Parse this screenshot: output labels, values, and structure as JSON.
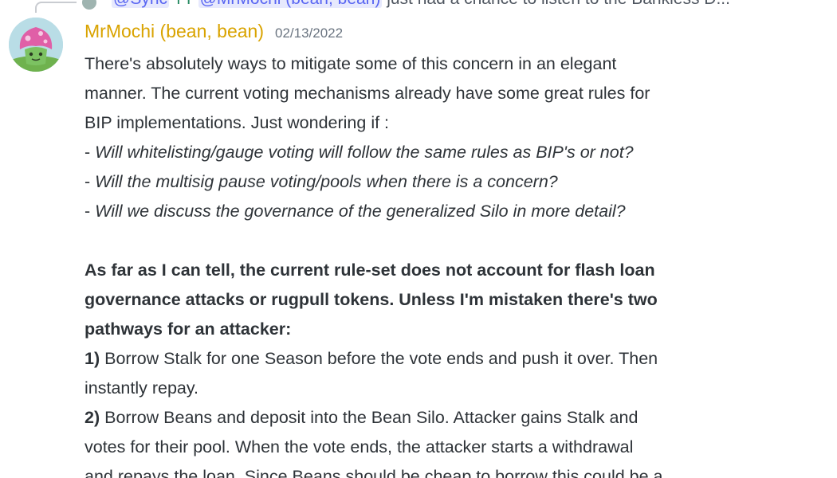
{
  "reply": {
    "mention_1": "@Sync",
    "author_tail": "TT",
    "mention_2": "@MrMochi (bean, bean)",
    "snippet": "just had a chance to listen to the Bankless D..."
  },
  "message": {
    "author": "MrMochi (bean, bean)",
    "timestamp": "02/13/2022",
    "author_color": "#d9a300",
    "lines": [
      "There's absolutely ways to mitigate some of this concern in an elegant",
      "manner. The current voting mechanisms already have some great rules for",
      "BIP implementations. Just wondering if :"
    ],
    "bullets": [
      {
        "dash": "- ",
        "text": "Will whitelisting/gauge voting will follow the same rules as BIP's or not?"
      },
      {
        "dash": "- ",
        "text": "Will the multisig pause voting/pools when there is a concern?"
      },
      {
        "dash": "- ",
        "text": "Will we discuss the governance of the generalized Silo in more detail?"
      }
    ],
    "bold_lines": [
      "As far as I can tell, the current rule-set does not account for flash loan",
      "governance attacks or rugpull tokens. Unless I'm mistaken there's two",
      "pathways for an attacker:"
    ],
    "pathway_1": {
      "num": "1)",
      "line1": " Borrow Stalk for one Season before the vote ends and push it over. Then",
      "line2": "instantly repay."
    },
    "pathway_2": {
      "num": "2)",
      "line1": " Borrow Beans and deposit into the Bean Silo. Attacker gains Stalk and",
      "line2": "votes for their pool. When the vote ends, the attacker starts a withdrawal",
      "line3": "and repays the loan. Since Beans should be cheap to borrow this could be a"
    }
  }
}
